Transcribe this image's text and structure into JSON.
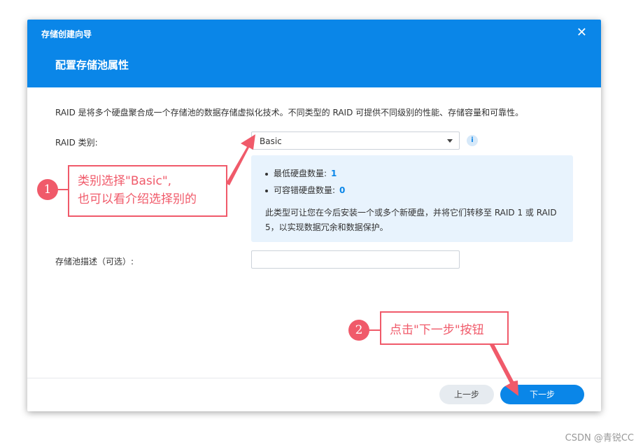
{
  "dialog": {
    "wizard_title": "存储创建向导",
    "close_glyph": "✕",
    "step_title": "配置存储池属性",
    "description": "RAID 是将多个硬盘聚合成一个存储池的数据存储虚拟化技术。不同类型的 RAID 可提供不同级别的性能、存储容量和可靠性。",
    "raid_type": {
      "label": "RAID 类别:",
      "selected": "Basic",
      "info_glyph": "i"
    },
    "info_box": {
      "min_disks_label": "最低硬盘数量:",
      "min_disks_value": "1",
      "fault_tolerance_label": "可容错硬盘数量:",
      "fault_tolerance_value": "0",
      "text": "此类型可让您在今后安装一个或多个新硬盘，并将它们转移至 RAID 1 或 RAID 5，以实现数据冗余和数据保护。"
    },
    "pool_description": {
      "label": "存储池描述（可选）:",
      "value": "",
      "placeholder": ""
    },
    "buttons": {
      "prev": "上一步",
      "next": "下一步"
    }
  },
  "annotations": {
    "step1_number": "1",
    "step1_line1": "类别选择\"Basic\",",
    "step1_line2": "也可以看介绍选择别的",
    "step2_number": "2",
    "step2_text": "点击\"下一步\"按钮",
    "color": "#f05a6a"
  },
  "theme": {
    "primary": "#0a86e8",
    "info_bg": "#e8f3fd"
  },
  "watermark": "CSDN @青锐CC"
}
